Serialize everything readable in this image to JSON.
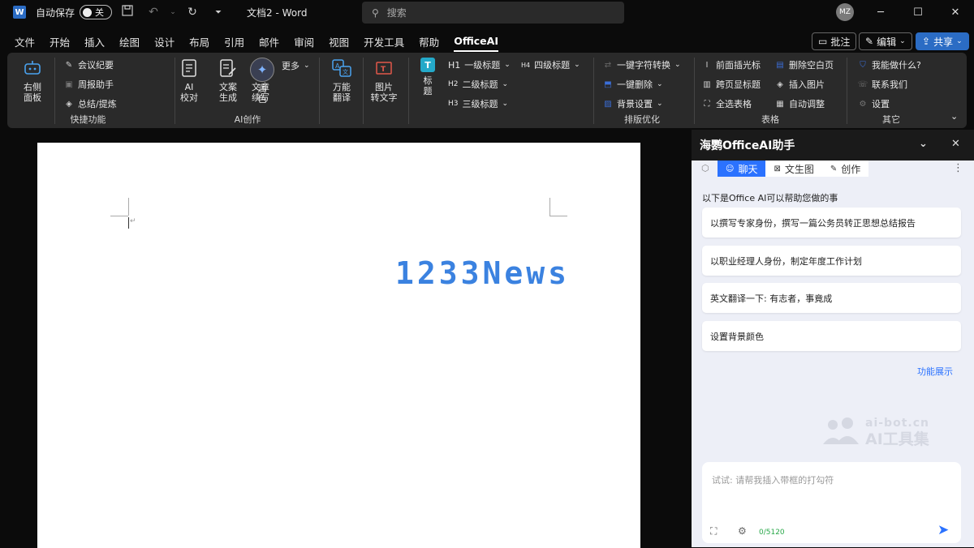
{
  "titlebar": {
    "autosave_label": "自动保存",
    "autosave_state": "关",
    "doc_title": "文档2 - Word",
    "search_placeholder": "搜索",
    "user_initials": "MZ"
  },
  "menubar": {
    "items": [
      "文件",
      "开始",
      "插入",
      "绘图",
      "设计",
      "布局",
      "引用",
      "邮件",
      "审阅",
      "视图",
      "开发工具",
      "帮助",
      "OfficeAI"
    ],
    "active": "OfficeAI",
    "comments_label": "批注",
    "edit_label": "编辑",
    "share_label": "共享"
  },
  "ribbon": {
    "quick": {
      "side_panel": "右侧\n面板",
      "meeting_notes": "会议纪要",
      "weekly_report": "周报助手",
      "summary": "总结/提炼",
      "label": "快捷功能"
    },
    "ai_create": {
      "ai_proofread": "AI\n校对",
      "copywriting": "文案\n生成",
      "article_continue": "文章\n续写",
      "polish": "润\n色",
      "more": "更多",
      "label": "AI创作"
    },
    "translate": "万能\n翻译",
    "image_to_text": "图片\n转文字",
    "headings": {
      "title": "标\n题",
      "h1": "一级标题",
      "h2": "二级标题",
      "h3": "三级标题",
      "h4": "四级标题",
      "h1_tag": "H1",
      "h2_tag": "H2",
      "h3_tag": "H3",
      "h4_tag": "H4"
    },
    "layout": {
      "char_convert": "一键字符转换",
      "one_click_delete": "一键删除",
      "background": "背景设置",
      "label": "排版优化"
    },
    "table": {
      "front_cursor": "前面插光标",
      "cross_page_header": "跨页显标题",
      "select_all_tables": "全选表格",
      "delete_blank_page": "删除空白页",
      "insert_image": "插入图片",
      "auto_adjust": "自动调整",
      "label": "表格"
    },
    "other": {
      "what_can_i_do": "我能做什么?",
      "contact_us": "联系我们",
      "settings": "设置",
      "label": "其它"
    }
  },
  "document": {
    "watermark": "1233News"
  },
  "panel": {
    "title": "海鹦OfficeAI助手",
    "tabs": [
      "聊天",
      "文生图",
      "创作"
    ],
    "intro": "以下是Office AI可以帮助您做的事",
    "suggestions": [
      "以撰写专家身份，撰写一篇公务员转正思想总结报告",
      "以职业经理人身份，制定年度工作计划",
      "英文翻译一下: 有志者，事竟成",
      "设置背景颜色"
    ],
    "feature_link": "功能展示",
    "watermark_top": "ai-bot.cn",
    "watermark_bottom": "AI工具集",
    "input_placeholder": "试试: 请帮我插入带框的打勾符",
    "char_counter": "0/5120",
    "accent_color": "#2b72ff"
  }
}
